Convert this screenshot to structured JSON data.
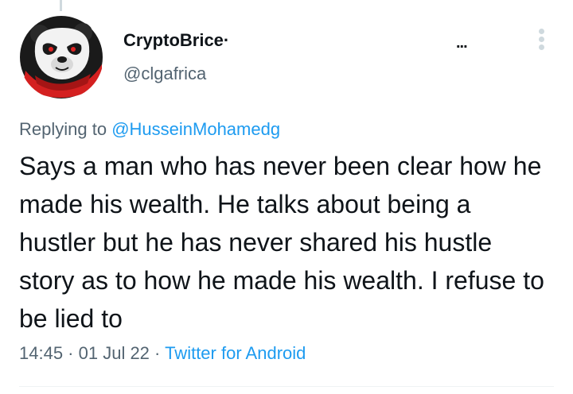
{
  "tweet": {
    "author": {
      "display_name": "CryptoBrice·",
      "handle": "@clgafrica",
      "avatar_icon": "panda-avatar"
    },
    "caret_label": "...",
    "menu_icon": "vertical-dots-icon",
    "replying_prefix": "Replying to ",
    "replying_to": "@HusseinMohamedg",
    "text": "Says a man who has never been clear how he made his wealth. He talks about being a hustler but he has never shared his hustle story as to how he made his wealth. I refuse to be lied to",
    "time": "14:45",
    "date": "01 Jul 22",
    "separator": " · ",
    "source": "Twitter for Android"
  },
  "colors": {
    "primary_text": "#0f1419",
    "secondary_text": "#536471",
    "link": "#1d9bf0",
    "divider": "#eff3f4",
    "avatar_red": "#d42020"
  }
}
